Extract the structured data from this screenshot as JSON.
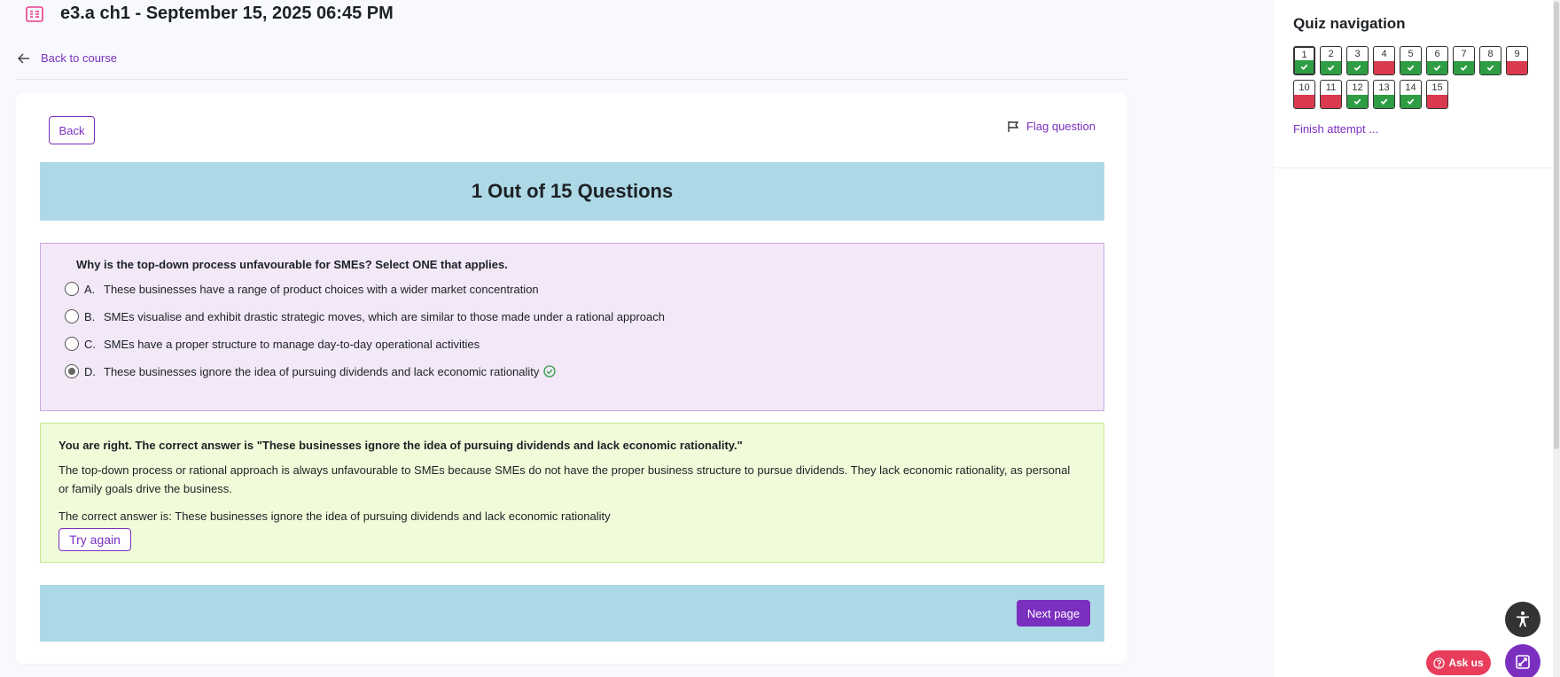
{
  "header": {
    "title": "e3.a ch1 - September 15, 2025 06:45 PM",
    "icon": "quiz-icon",
    "accent_color": "#e83e8c"
  },
  "back_link": {
    "label": "Back to course"
  },
  "card": {
    "back_button": "Back",
    "flag_label": "Flag question",
    "progress_banner": "1 Out of 15 Questions",
    "question": {
      "text": "Why is the top-down process unfavourable for SMEs? Select ONE that applies.",
      "answers": [
        {
          "letter": "A.",
          "text": "These businesses have a range of product choices with a wider market concentration",
          "selected": false
        },
        {
          "letter": "B.",
          "text": "SMEs visualise and exhibit drastic strategic moves, which are similar to those made under a rational approach",
          "selected": false
        },
        {
          "letter": "C.",
          "text": "SMEs have a proper structure to manage day-to-day operational activities",
          "selected": false
        },
        {
          "letter": "D.",
          "text": "These businesses ignore the idea of pursuing dividends and lack economic rationality",
          "selected": true
        }
      ]
    },
    "feedback": {
      "title": "You are right. The correct answer is \"These businesses ignore the idea of pursuing dividends and lack economic rationality.\"",
      "explanation": "The top-down process or rational approach is always unfavourable to SMEs because SMEs do not have the proper business structure to pursue dividends. They lack economic rationality, as personal or family goals drive the business.",
      "correct_answer": "The correct answer is: These businesses ignore the idea of pursuing dividends and lack economic rationality",
      "try_again": "Try again"
    },
    "next_button": "Next page"
  },
  "quiz_nav": {
    "title": "Quiz navigation",
    "questions": [
      {
        "num": "1",
        "state": "correct",
        "current": true
      },
      {
        "num": "2",
        "state": "correct"
      },
      {
        "num": "3",
        "state": "correct"
      },
      {
        "num": "4",
        "state": "wrong"
      },
      {
        "num": "5",
        "state": "correct"
      },
      {
        "num": "6",
        "state": "correct"
      },
      {
        "num": "7",
        "state": "correct"
      },
      {
        "num": "8",
        "state": "correct"
      },
      {
        "num": "9",
        "state": "wrong"
      },
      {
        "num": "10",
        "state": "wrong"
      },
      {
        "num": "11",
        "state": "wrong"
      },
      {
        "num": "12",
        "state": "correct"
      },
      {
        "num": "13",
        "state": "correct"
      },
      {
        "num": "14",
        "state": "correct"
      },
      {
        "num": "15",
        "state": "wrong"
      }
    ],
    "finish_label": "Finish attempt ..."
  },
  "floating": {
    "ask_label": "Ask us"
  },
  "colors": {
    "brand": "#7b2fbf",
    "banner": "#add8e6",
    "correct": "#2e9d44",
    "wrong": "#d93a4d"
  }
}
